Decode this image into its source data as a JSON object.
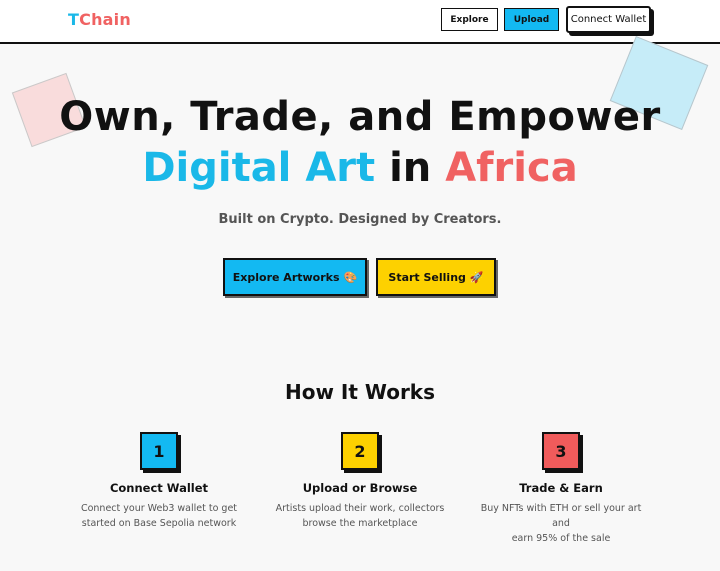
{
  "header": {
    "logo_first": "T",
    "logo_rest": "Chain",
    "nav": {
      "explore_label": "Explore",
      "upload_label": "Upload",
      "connect_label": "Connect Wallet"
    }
  },
  "hero": {
    "line1": "Own, Trade, and Empower",
    "line2_part1": "Digital Art",
    "line2_part2": "in",
    "line2_part3": "Africa",
    "tagline": "Built on Crypto. Designed by Creators.",
    "explore_label": "Explore Artworks",
    "explore_emoji": "🎨",
    "sell_label": "Start Selling",
    "sell_emoji": "🚀"
  },
  "how_it_works": {
    "title": "How It Works",
    "steps": [
      {
        "number": "1",
        "title": "Connect Wallet",
        "desc_line1": "Connect your Web3 wallet to get",
        "desc_line2": "started on Base Sepolia network"
      },
      {
        "number": "2",
        "title": "Upload or Browse",
        "desc_line1": "Artists upload their work, collectors",
        "desc_line2": "browse the marketplace"
      },
      {
        "number": "3",
        "title": "Trade & Earn",
        "desc_line1": "Buy NFTs with ETH or sell your art and",
        "desc_line2": "earn 95% of the sale"
      }
    ]
  },
  "colors": {
    "brand_blue": "#13b9f2",
    "brand_yellow": "#fdd100",
    "brand_red": "#f05b5b"
  }
}
